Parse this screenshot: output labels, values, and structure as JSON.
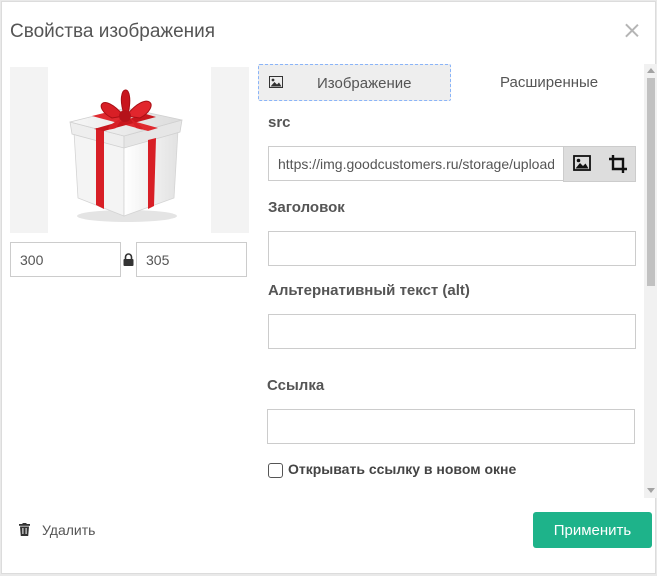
{
  "dialog": {
    "title": "Свойства изображения",
    "close_icon": "close-icon"
  },
  "preview": {
    "width": "300",
    "height": "305",
    "lock_icon": "lock-icon",
    "image_icon": "gift-image"
  },
  "tabs": [
    {
      "label": "Изображение",
      "icon": "image-icon",
      "active": true
    },
    {
      "label": "Расширенные",
      "active": false
    }
  ],
  "form": {
    "src_label": "src",
    "src_value": "https://img.goodcustomers.ru/storage/uploads/gift.png",
    "src_buttons": [
      "image-icon",
      "crop-icon"
    ],
    "title_label": "Заголовок",
    "title_value": "",
    "alt_label": "Альтернативный текст (alt)",
    "alt_value": "",
    "link_label": "Ссылка",
    "link_value": "",
    "new_window_label": "Открывать ссылку в новом окне",
    "new_window_checked": false
  },
  "footer": {
    "delete_label": "Удалить",
    "delete_icon": "trash-icon",
    "apply_label": "Применить"
  },
  "colors": {
    "accent": "#1eb38a",
    "tab_outline": "#8ab4f8"
  }
}
